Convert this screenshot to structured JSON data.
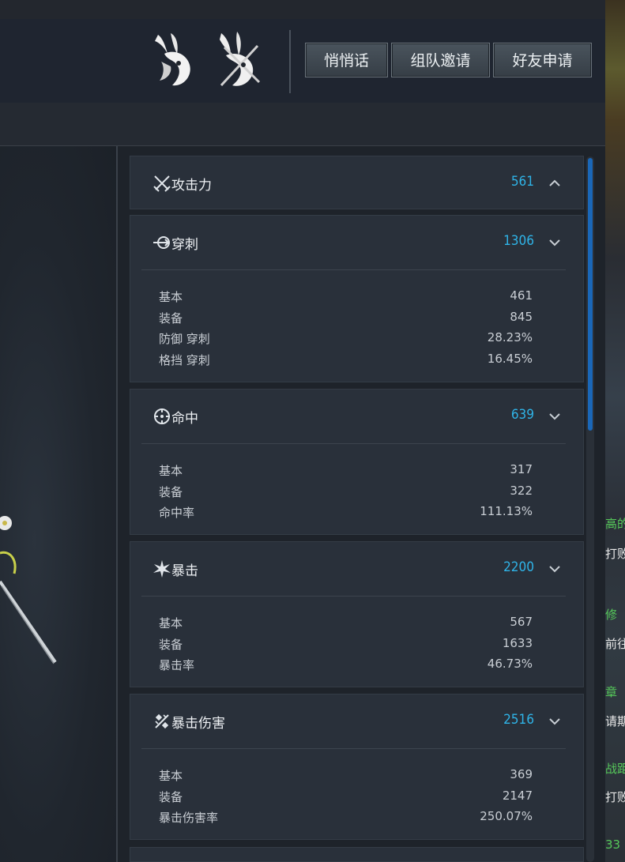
{
  "header": {
    "buttons": [
      "悄悄话",
      "组队邀请",
      "好友申请"
    ]
  },
  "colors": {
    "value_accent": "#2fb4e8",
    "scroll_thumb": "#1a67b8"
  },
  "stats": [
    {
      "icon": "swords-icon",
      "title": "攻击力",
      "value": "561",
      "expanded": true,
      "chevron": "chevron-up-icon",
      "details": []
    },
    {
      "icon": "pierce-icon",
      "title": "穿刺",
      "value": "1306",
      "chevron": "chevron-down-icon",
      "details": [
        {
          "label": "基本",
          "value": "461"
        },
        {
          "label": "装备",
          "value": "845"
        },
        {
          "label": "防御 穿刺",
          "value": "28.23%"
        },
        {
          "label": "格挡 穿刺",
          "value": "16.45%"
        }
      ]
    },
    {
      "icon": "crosshair-icon",
      "title": "命中",
      "value": "639",
      "chevron": "chevron-down-icon",
      "details": [
        {
          "label": "基本",
          "value": "317"
        },
        {
          "label": "装备",
          "value": "322"
        },
        {
          "label": "命中率",
          "value": "111.13%"
        }
      ]
    },
    {
      "icon": "burst-icon",
      "title": "暴击",
      "value": "2200",
      "chevron": "chevron-down-icon",
      "details": [
        {
          "label": "基本",
          "value": "567"
        },
        {
          "label": "装备",
          "value": "1633"
        },
        {
          "label": "暴击率",
          "value": "46.73%"
        }
      ]
    },
    {
      "icon": "crit-damage-icon",
      "title": "暴击伤害",
      "value": "2516",
      "chevron": "chevron-down-icon",
      "details": [
        {
          "label": "基本",
          "value": "369"
        },
        {
          "label": "装备",
          "value": "2147"
        },
        {
          "label": "暴击伤害率",
          "value": "250.07%"
        }
      ]
    }
  ],
  "edge_text": [
    "高的",
    "打败",
    "修",
    "前往",
    "章",
    "请期",
    "战距",
    "打败",
    "33"
  ]
}
